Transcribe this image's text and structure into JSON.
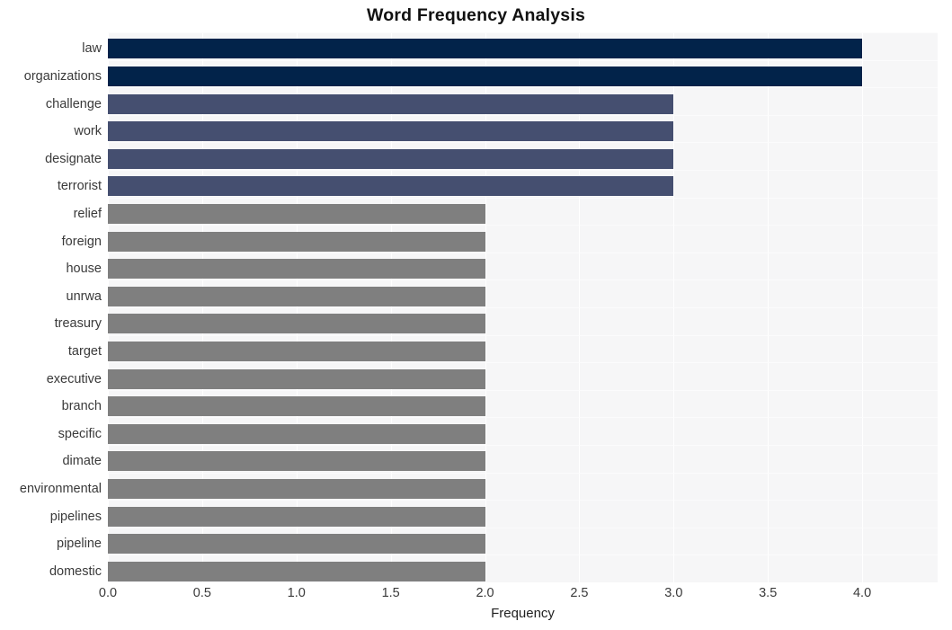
{
  "chart_data": {
    "type": "bar",
    "orientation": "horizontal",
    "title": "Word Frequency Analysis",
    "xlabel": "Frequency",
    "ylabel": "",
    "xlim": [
      0.0,
      4.4
    ],
    "xticks": [
      "0.0",
      "0.5",
      "1.0",
      "1.5",
      "2.0",
      "2.5",
      "3.0",
      "3.5",
      "4.0"
    ],
    "xtick_values": [
      0.0,
      0.5,
      1.0,
      1.5,
      2.0,
      2.5,
      3.0,
      3.5,
      4.0
    ],
    "grid": "white gridlines on light gray panel",
    "legend": "none",
    "categories": [
      "law",
      "organizations",
      "challenge",
      "work",
      "designate",
      "terrorist",
      "relief",
      "foreign",
      "house",
      "unrwa",
      "treasury",
      "target",
      "executive",
      "branch",
      "specific",
      "dimate",
      "environmental",
      "pipelines",
      "pipeline",
      "domestic"
    ],
    "values": [
      4,
      4,
      3,
      3,
      3,
      3,
      2,
      2,
      2,
      2,
      2,
      2,
      2,
      2,
      2,
      2,
      2,
      2,
      2,
      2
    ],
    "bar_colors": [
      "#02234a",
      "#02234a",
      "#454f70",
      "#454f70",
      "#454f70",
      "#454f70",
      "#7f7f7f",
      "#7f7f7f",
      "#7f7f7f",
      "#7f7f7f",
      "#7f7f7f",
      "#7f7f7f",
      "#7f7f7f",
      "#7f7f7f",
      "#7f7f7f",
      "#7f7f7f",
      "#7f7f7f",
      "#7f7f7f",
      "#7f7f7f",
      "#7f7f7f"
    ],
    "palette": {
      "navy": "#02234a",
      "slate_blue": "#454f70",
      "gray": "#7f7f7f",
      "panel_background": "#f6f6f7",
      "figure_background": "#ffffff",
      "gridline": "#ffffff",
      "tick_text": "#3a3a3a",
      "title_text": "#111111"
    }
  }
}
